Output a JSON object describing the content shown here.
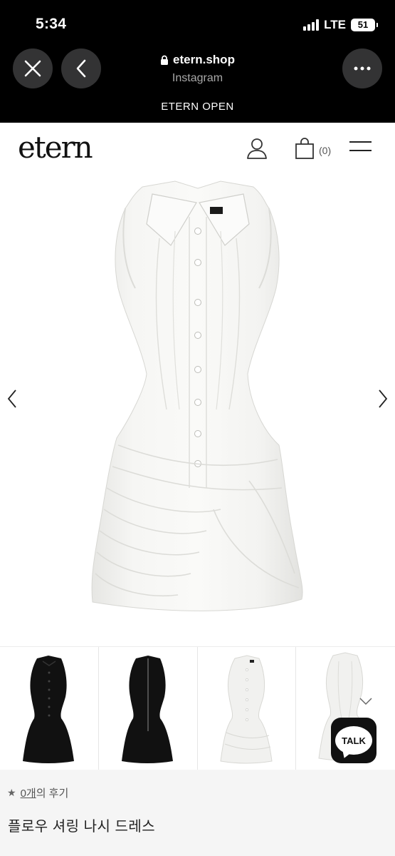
{
  "status_bar": {
    "time": "5:34",
    "network": "LTE",
    "battery": "51"
  },
  "browser": {
    "close_icon": "close-icon",
    "back_icon": "chevron-left-icon",
    "more_icon": "more-horizontal-icon",
    "lock_icon": "lock-icon",
    "url": "etern.shop",
    "subtitle": "Instagram"
  },
  "banner": {
    "text": "ETERN OPEN"
  },
  "header": {
    "logo": "etern",
    "account_icon": "user-icon",
    "cart_icon": "shopping-bag-icon",
    "cart_count": "(0)",
    "menu_icon": "hamburger-menu-icon"
  },
  "gallery": {
    "prev_icon": "chevron-left-icon",
    "next_icon": "chevron-right-icon",
    "main_image": "white-sleeveless-shirred-dress",
    "thumbnails": [
      {
        "image": "black-dress-front"
      },
      {
        "image": "black-dress-back"
      },
      {
        "image": "white-dress-front"
      },
      {
        "image": "white-dress-back"
      }
    ]
  },
  "chat": {
    "label": "TALK",
    "expand_icon": "chevron-down-icon"
  },
  "product": {
    "star_icon": "★",
    "review_count": "0개",
    "review_suffix": "의 후기",
    "name": "플로우 셔링 나시 드레스"
  },
  "colors": {
    "topbar_bg": "#000000",
    "button_bg": "#333334",
    "info_bg": "#f5f5f5",
    "dress_white": "#f3f3f1",
    "dress_black": "#111111"
  }
}
